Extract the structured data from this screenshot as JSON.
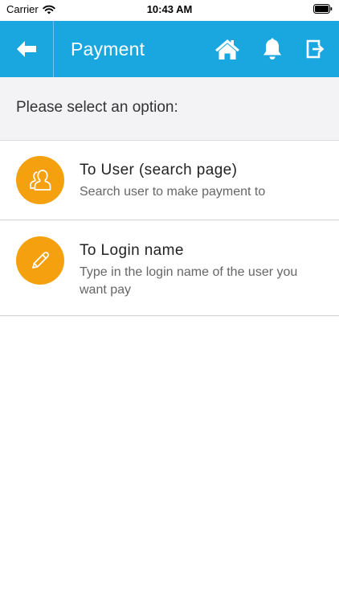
{
  "status_bar": {
    "carrier": "Carrier",
    "time": "10:43 AM"
  },
  "header": {
    "title": "Payment",
    "background_color": "#1aa7e0",
    "icons": [
      "arrow-left-icon",
      "home-icon",
      "bell-icon",
      "logout-icon"
    ]
  },
  "prompt": {
    "text": "Please select an option:"
  },
  "options": [
    {
      "title": "To User (search page)",
      "subtitle": "Search user to make payment to",
      "icon": "users-icon",
      "icon_color": "#f5a00f"
    },
    {
      "title": "To Login name",
      "subtitle": "Type in the login name of the user you want pay",
      "icon": "pencil-icon",
      "icon_color": "#f5a00f"
    }
  ]
}
